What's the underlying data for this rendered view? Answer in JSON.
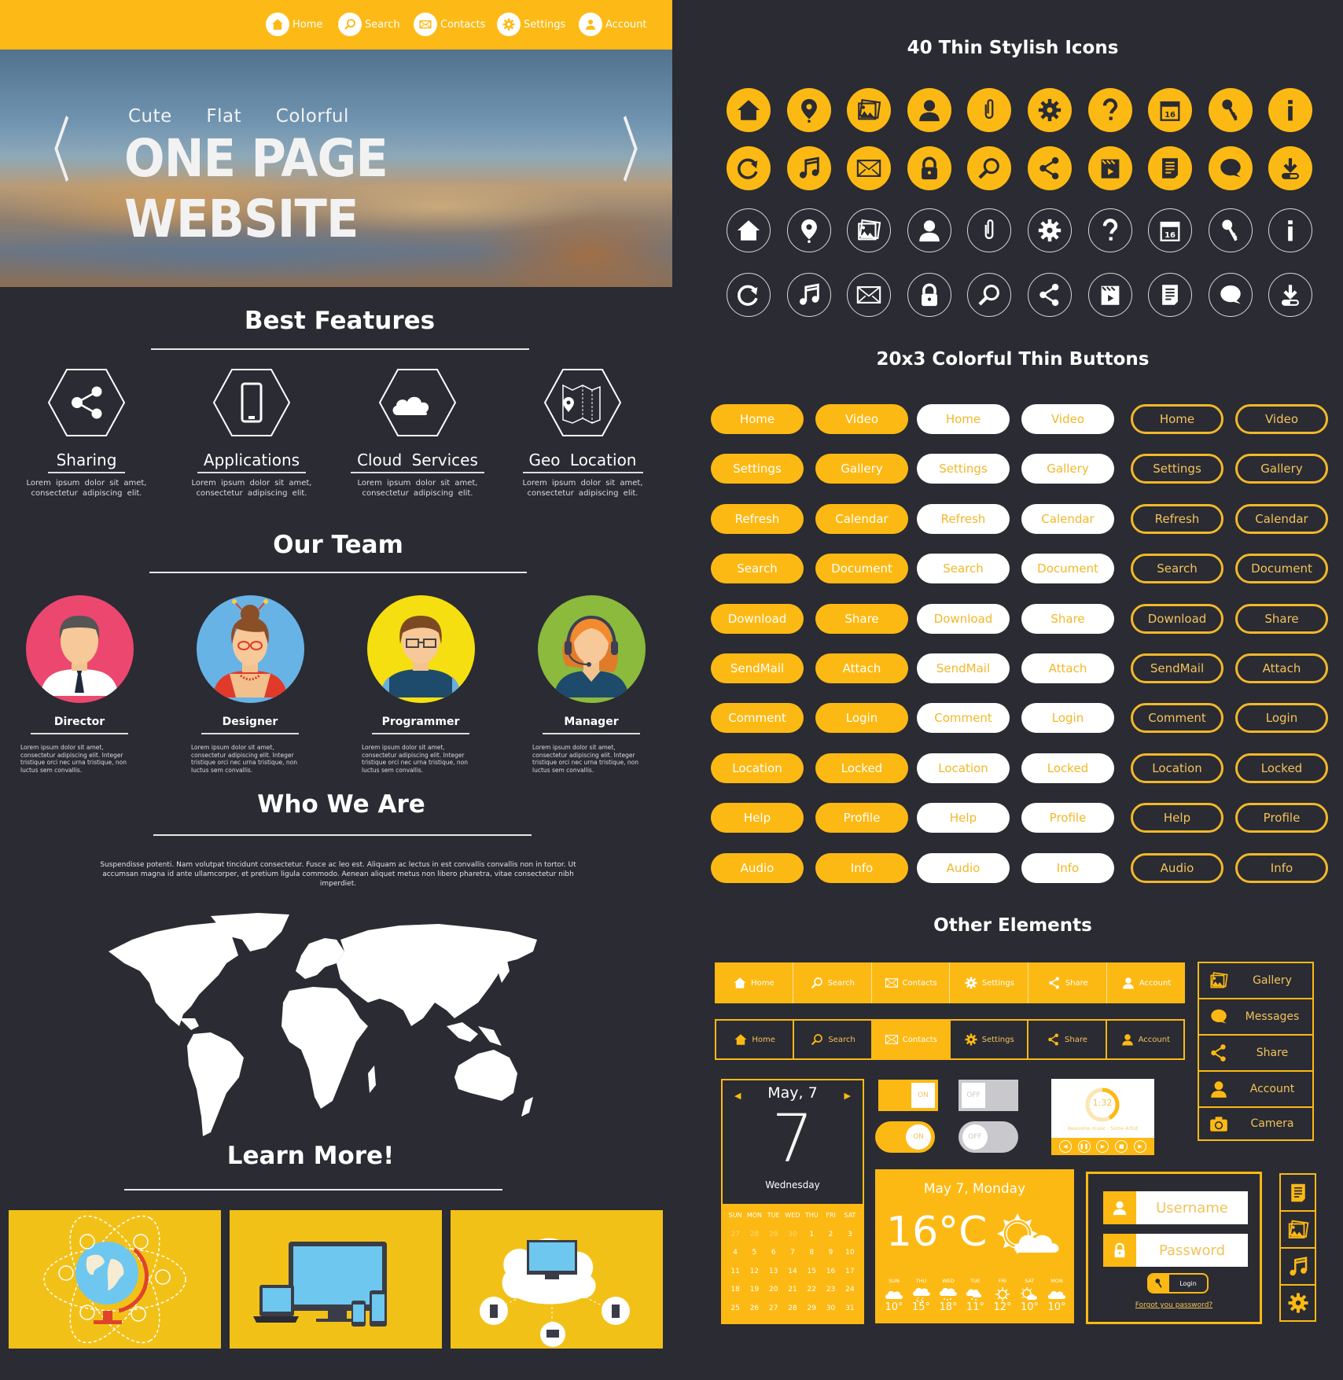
{
  "colors": {
    "accent": "#fdb913",
    "background": "#2a2b33",
    "text": "#ffffff"
  },
  "top_nav": {
    "items": [
      {
        "label": "Home",
        "icon": "home-icon"
      },
      {
        "label": "Search",
        "icon": "search-icon"
      },
      {
        "label": "Contacts",
        "icon": "mail-icon"
      },
      {
        "label": "Settings",
        "icon": "gear-icon"
      },
      {
        "label": "Account",
        "icon": "account-icon"
      }
    ]
  },
  "hero": {
    "tagline": "Cute  Flat  Colorful",
    "title": "ONE PAGE WEBSITE",
    "prev": "〈",
    "next": "〉"
  },
  "features": {
    "title": "Best Features",
    "items": [
      {
        "title": "Sharing",
        "icon": "share-icon",
        "desc": "Lorem ipsum dolor sit amet, consectetur adipiscing elit."
      },
      {
        "title": "Applications",
        "icon": "smartphone-icon",
        "desc": "Lorem ipsum dolor sit amet, consectetur adipiscing elit."
      },
      {
        "title": "Cloud Services",
        "icon": "cloud-icon",
        "desc": "Lorem ipsum dolor sit amet, consectetur adipiscing elit."
      },
      {
        "title": "Geo Location",
        "icon": "map-location-icon",
        "desc": "Lorem ipsum dolor sit amet, consectetur adipiscing elit."
      }
    ]
  },
  "team": {
    "title": "Our Team",
    "members": [
      {
        "name": "Director",
        "desc": "Lorem ipsum dolor sit amet, consectetur adipiscing elit. Integer tristique orci nec urna tristique, non luctus sem convallis."
      },
      {
        "name": "Designer",
        "desc": "Lorem ipsum dolor sit amet, consectetur adipiscing elit. Integer tristique orci nec urna tristique, non luctus sem convallis."
      },
      {
        "name": "Programmer",
        "desc": "Lorem ipsum dolor sit amet, consectetur adipiscing elit. Integer tristique orci nec urna tristique, non luctus sem convallis."
      },
      {
        "name": "Manager",
        "desc": "Lorem ipsum dolor sit amet, consectetur adipiscing elit. Integer tristique orci nec urna tristique, non luctus sem convallis."
      }
    ]
  },
  "who": {
    "title": "Who We Are",
    "text": "Suspendisse potenti. Nam volutpat tincidunt consectetur. Fusce ac leo est. Aliquam ac lectus in est convallis convallis non in tortor. Ut accumsan magna id ante ullamcorper, et pretium ligula commodo. Aenean aliquet metus non libero pharetra, vitae consectetur nibh imperdiet."
  },
  "learn": {
    "title": "Learn More!",
    "cards": [
      {
        "name": "globe-network-illustration"
      },
      {
        "name": "responsive-devices-illustration"
      },
      {
        "name": "cloud-devices-illustration"
      }
    ]
  },
  "icons_section": {
    "title": "40 Thin Stylish Icons",
    "row_a": [
      "home-icon",
      "location-pin-icon",
      "gallery-icon",
      "user-icon",
      "paperclip-icon",
      "gear-icon",
      "question-icon",
      "calendar-icon",
      "key-icon",
      "info-icon"
    ],
    "row_b": [
      "refresh-icon",
      "music-icon",
      "mail-icon",
      "lock-icon",
      "search-icon",
      "share-icon",
      "video-icon",
      "document-icon",
      "comment-icon",
      "download-icon"
    ],
    "calendar_day": "16"
  },
  "buttons_section": {
    "title": "20x3 Colorful Thin  Buttons",
    "pairs": [
      [
        "Home",
        "Video"
      ],
      [
        "Settings",
        "Gallery"
      ],
      [
        "Refresh",
        "Calendar"
      ],
      [
        "Search",
        "Document"
      ],
      [
        "Download",
        "Share"
      ],
      [
        "SendMail",
        "Attach"
      ],
      [
        "Comment",
        "Login"
      ],
      [
        "Location",
        "Locked"
      ],
      [
        "Help",
        "Profile"
      ],
      [
        "Audio",
        "Info"
      ]
    ]
  },
  "other": {
    "title": "Other Elements",
    "nav_items": [
      {
        "label": "Home",
        "icon": "home-icon"
      },
      {
        "label": "Search",
        "icon": "search-icon"
      },
      {
        "label": "Contacts",
        "icon": "mail-icon"
      },
      {
        "label": "Settings",
        "icon": "gear-icon"
      },
      {
        "label": "Share",
        "icon": "share-icon"
      },
      {
        "label": "Account",
        "icon": "account-icon"
      }
    ],
    "nav2_active": "Contacts",
    "side_list": [
      {
        "label": "Gallery",
        "icon": "gallery-icon"
      },
      {
        "label": "Messages",
        "icon": "comment-icon"
      },
      {
        "label": "Share",
        "icon": "share-icon"
      },
      {
        "label": "Account",
        "icon": "account-icon"
      },
      {
        "label": "Camera",
        "icon": "camera-icon"
      }
    ],
    "calendar": {
      "month_label": "May, 7",
      "day": "7",
      "weekday": "Wednesday",
      "headers": [
        "SUN",
        "MON",
        "TUE",
        "WED",
        "THU",
        "FRI",
        "SAT"
      ],
      "weeks": [
        [
          "27",
          "28",
          "29",
          "30",
          "1",
          "2",
          "3"
        ],
        [
          "4",
          "5",
          "6",
          "7",
          "8",
          "9",
          "10"
        ],
        [
          "11",
          "12",
          "13",
          "14",
          "15",
          "16",
          "17"
        ],
        [
          "18",
          "19",
          "20",
          "21",
          "22",
          "23",
          "24"
        ],
        [
          "25",
          "26",
          "27",
          "28",
          "29",
          "30",
          "31"
        ]
      ],
      "muted_first_row_count": 4
    },
    "toggles": {
      "square_on": "ON",
      "square_off": "OFF",
      "round_on": "ON",
      "round_off": "OFF"
    },
    "player": {
      "time": "1:32",
      "track": "Awesome music - Some Artist",
      "progress": 0.42,
      "controls": [
        "previous",
        "pause",
        "play",
        "stop",
        "next"
      ]
    },
    "weather": {
      "date": "May 7, Monday",
      "temp": "16°C",
      "condition": "partly-cloudy",
      "forecast": [
        {
          "day": "SUN",
          "temp": "10°",
          "icon": "cloudy"
        },
        {
          "day": "THU",
          "temp": "15°",
          "icon": "storm"
        },
        {
          "day": "WED",
          "temp": "18°",
          "icon": "rain"
        },
        {
          "day": "TUE",
          "temp": "11°",
          "icon": "rain-cloud"
        },
        {
          "day": "FRI",
          "temp": "12°",
          "icon": "sunny"
        },
        {
          "day": "SAT",
          "temp": "10°",
          "icon": "partly-cloudy"
        },
        {
          "day": "MON",
          "temp": "10°",
          "icon": "cloudy"
        }
      ]
    },
    "login": {
      "username_placeholder": "Username",
      "password_placeholder": "Password",
      "button": "Login",
      "forgot": "Forgot you password?"
    },
    "side_icons": [
      "document-icon",
      "gallery-icon",
      "music-icon",
      "gear-icon"
    ]
  }
}
